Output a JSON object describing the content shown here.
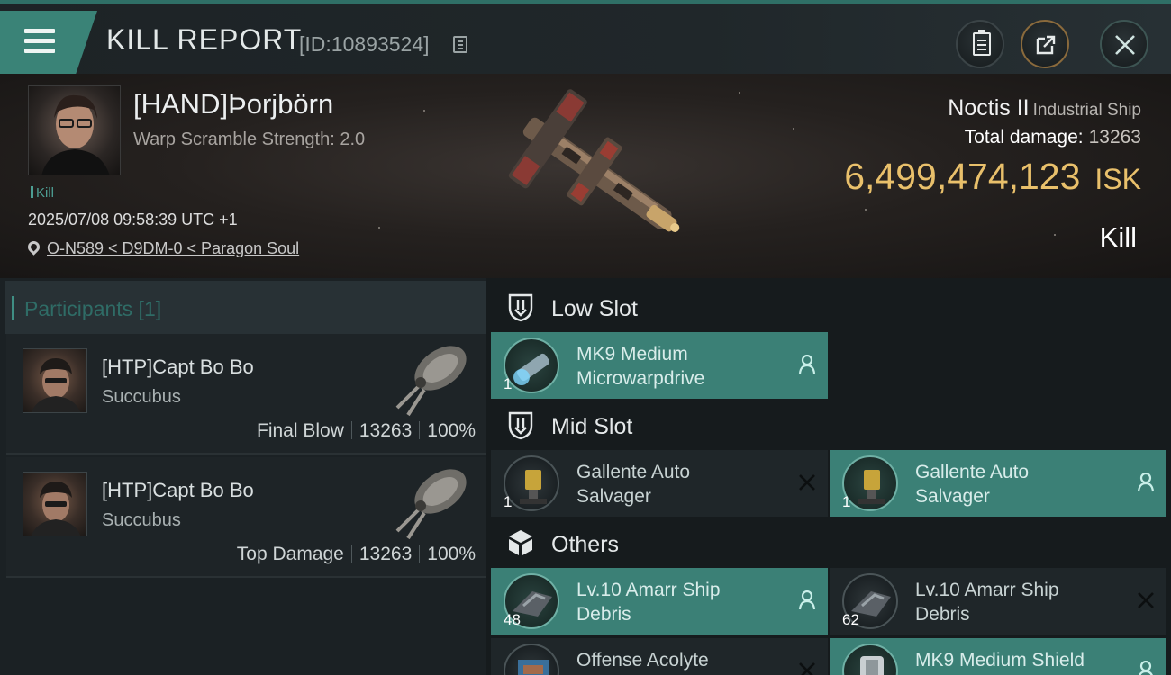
{
  "header": {
    "title": "KILL REPORT",
    "report_id": "[ID:10893524]"
  },
  "victim": {
    "name": "[HAND]Þorjbörn",
    "warp_scramble": "Warp Scramble Strength: 2.0",
    "tag": "Kill",
    "timestamp": "2025/07/08 09:58:39 UTC +1",
    "location": "O-N589 < D9DM-0 < Paragon Soul",
    "ship_name": "Noctis II",
    "ship_class": "Industrial Ship",
    "total_damage_label": "Total damage:",
    "total_damage": "13263",
    "isk_value": "6,499,474,123",
    "isk_unit": "ISK",
    "result": "Kill"
  },
  "participants": {
    "title": "Participants [1]",
    "rows": [
      {
        "name": "[HTP]Capt Bo Bo",
        "ship": "Succubus",
        "role": "Final Blow",
        "damage": "13263",
        "percent": "100%"
      },
      {
        "name": "[HTP]Capt Bo Bo",
        "ship": "Succubus",
        "role": "Top Damage",
        "damage": "13263",
        "percent": "100%"
      }
    ]
  },
  "fitting": {
    "low_slot": {
      "label": "Low Slot",
      "items": [
        {
          "line1": "MK9 Medium",
          "line2": "Microwarpdrive",
          "qty": "1",
          "state": "fitted"
        }
      ]
    },
    "mid_slot": {
      "label": "Mid Slot",
      "items": [
        {
          "line1": "Gallente Auto",
          "line2": "Salvager",
          "qty": "1",
          "state": "destroyed"
        },
        {
          "line1": "Gallente Auto",
          "line2": "Salvager",
          "qty": "1",
          "state": "fitted"
        }
      ]
    },
    "others": {
      "label": "Others",
      "items": [
        {
          "line1": "Lv.10 Amarr Ship",
          "line2": "Debris",
          "qty": "48",
          "state": "fitted"
        },
        {
          "line1": "Lv.10 Amarr Ship",
          "line2": "Debris",
          "qty": "62",
          "state": "destroyed"
        },
        {
          "line1": "Offense Acolyte",
          "line2": "",
          "qty": "",
          "state": "destroyed"
        },
        {
          "line1": "MK9 Medium Shield",
          "line2": "",
          "qty": "",
          "state": "fitted"
        }
      ]
    }
  },
  "colors": {
    "accent": "#3b8076",
    "isk": "#e9c06b",
    "panel": "#1b2124"
  }
}
